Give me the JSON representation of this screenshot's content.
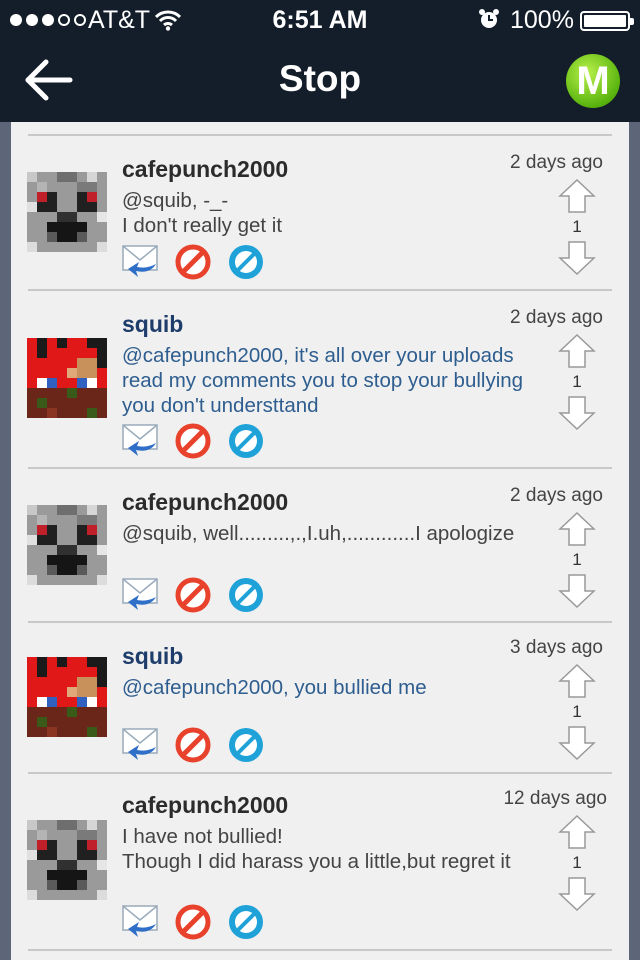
{
  "status_bar": {
    "carrier": "AT&T",
    "time": "6:51 AM",
    "battery_text": "100%",
    "signal_full": 3,
    "signal_empty": 2
  },
  "nav": {
    "title": "Stop",
    "back_icon": "back-arrow-icon",
    "logo_letter": "M"
  },
  "comments": [
    {
      "user": "cafepunch2000",
      "user_color": "dark",
      "avatar": "gray-creeper-avatar",
      "text": "@squib, -_-\nI don't really get it",
      "text_color": "dark",
      "date": "2 days ago",
      "votes": "1"
    },
    {
      "user": "squib",
      "user_color": "blue",
      "avatar": "red-pixel-avatar",
      "text": "@cafepunch2000, it's all over your uploads read my comments you to stop your bullying you don't understtand",
      "text_color": "blue",
      "date": "2 days ago",
      "votes": "1"
    },
    {
      "user": "cafepunch2000",
      "user_color": "dark",
      "avatar": "gray-creeper-avatar",
      "text": "@squib, well.........,.,I.uh,............I apologize",
      "text_color": "dark",
      "date": "2 days ago",
      "votes": "1"
    },
    {
      "user": "squib",
      "user_color": "blue",
      "avatar": "red-pixel-avatar",
      "text": "@cafepunch2000, you bullied me",
      "text_color": "blue",
      "date": "3 days ago",
      "votes": "1"
    },
    {
      "user": "cafepunch2000",
      "user_color": "dark",
      "avatar": "gray-creeper-avatar",
      "text": "I have not bullied!\nThough I did harass you a little,but regret it",
      "text_color": "dark",
      "date": "12 days ago",
      "votes": "1"
    }
  ],
  "colors": {
    "bar_bg": "#141e2a",
    "panel_bg": "#f0f0f0",
    "blue_text": "#2e5d8f",
    "flag_red": "#e8422c",
    "block_blue": "#1fa2d8"
  }
}
